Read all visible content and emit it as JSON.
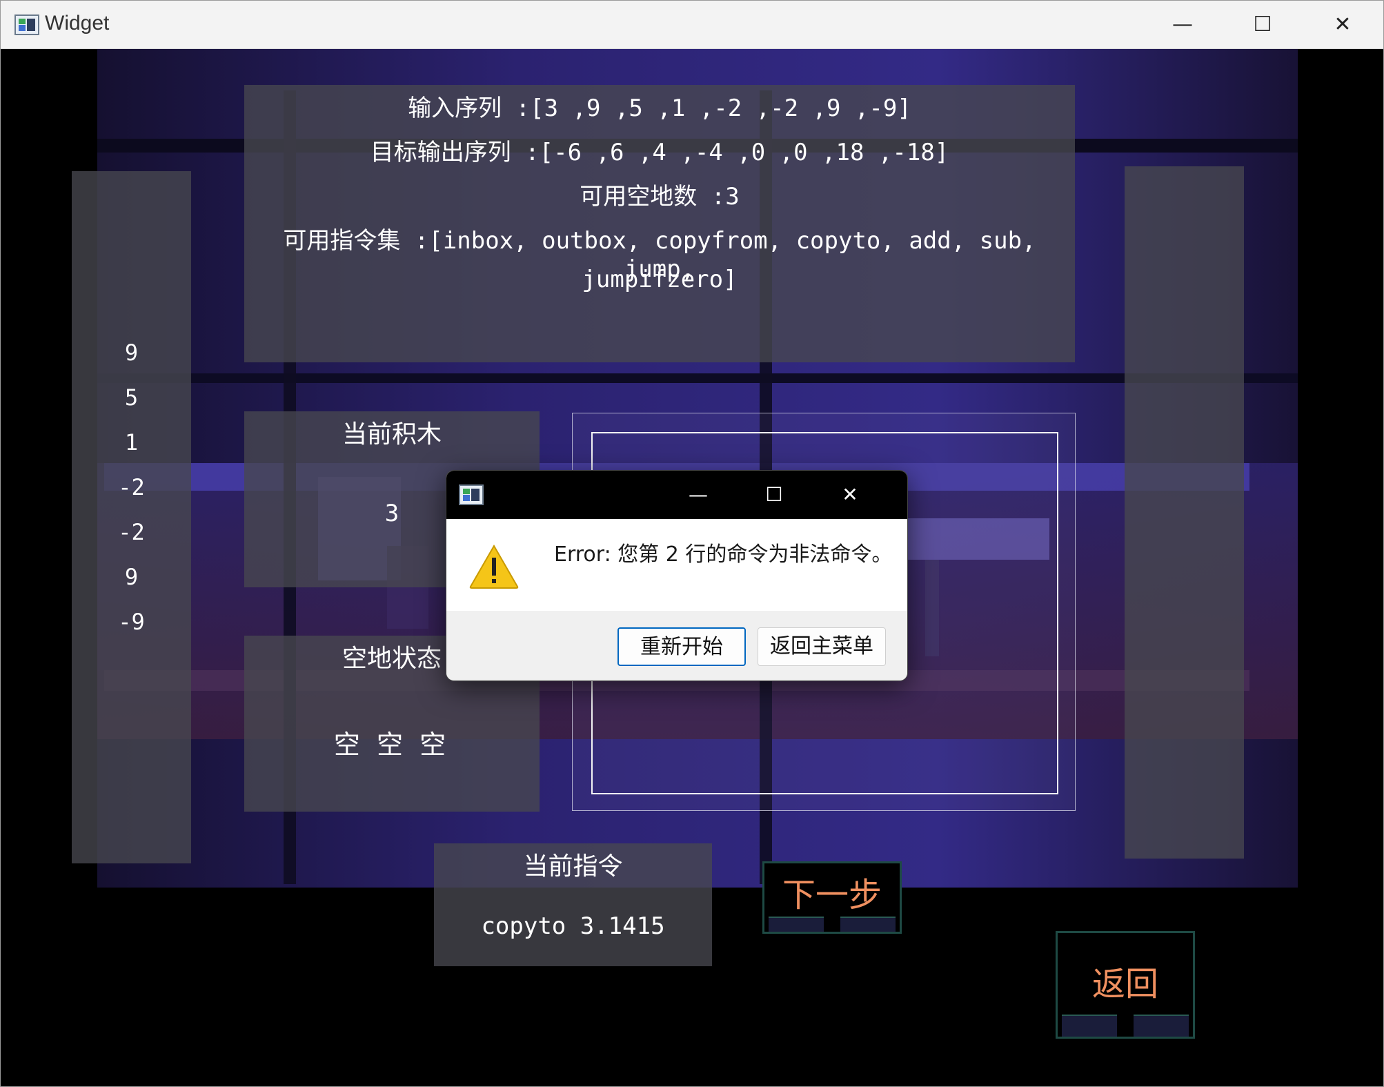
{
  "window": {
    "title": "Widget",
    "controls": {
      "minimize": "—",
      "maximize": "☐",
      "close": "✕"
    }
  },
  "info": {
    "input_sequence": "输入序列 :[3 ,9 ,5 ,1 ,-2 ,-2 ,9 ,-9]",
    "target_output": "目标输出序列 :[-6 ,6 ,4 ,-4 ,0 ,0 ,18 ,-18]",
    "available_spaces": "可用空地数 :3",
    "instructions_line1": "可用指令集 :[inbox, outbox, copyfrom, copyto, add, sub, jump,",
    "instructions_line2": "jumpifzero]"
  },
  "input_column": {
    "items": [
      "9",
      "5",
      "1",
      "-2",
      "-2",
      "9",
      "-9"
    ]
  },
  "current_block": {
    "heading": "当前积木",
    "value": "3"
  },
  "ground_state": {
    "heading": "空地状态",
    "cells": [
      "空",
      "空",
      "空"
    ]
  },
  "current_command": {
    "heading": "当前指令",
    "value": "copyto 3.1415"
  },
  "buttons": {
    "next_step": "下一步",
    "back": "返回"
  },
  "dialog": {
    "message": "Error: 您第 2 行的命令为非法命令。",
    "restart_button": "重新开始",
    "main_menu_button": "返回主菜单",
    "controls": {
      "minimize": "—",
      "maximize": "☐",
      "close": "✕"
    }
  },
  "colors": {
    "panel": "#48484f",
    "button_text": "#f09060",
    "button_border": "#1e4a44",
    "dialog_focus": "#0067c0",
    "warning": "#f5c518"
  }
}
